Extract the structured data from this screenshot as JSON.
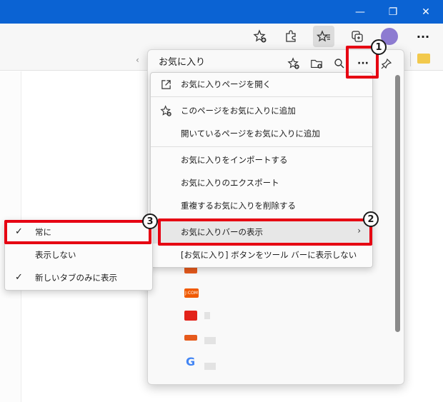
{
  "titlebar": {
    "minimize_glyph": "—",
    "maximize_glyph": "❐",
    "close_glyph": "✕"
  },
  "toolbar": {
    "more_glyph": "···"
  },
  "favorites_panel": {
    "title": "お気に入り",
    "more_glyph": "···",
    "search_glyph": "⚲"
  },
  "menu": {
    "items": [
      {
        "label": "お気に入りページを開く"
      },
      {
        "label": "このページをお気に入りに追加"
      },
      {
        "label": "開いているページをお気に入りに追加"
      },
      {
        "label": "お気に入りをインポートする"
      },
      {
        "label": "お気に入りのエクスポート"
      },
      {
        "label": "重複するお気に入りを削除する"
      },
      {
        "label": "お気に入りバーの表示",
        "arrow": "›"
      },
      {
        "label": "[お気に入り] ボタンをツール バーに表示しない"
      }
    ]
  },
  "submenu": {
    "items": [
      {
        "label": "常に",
        "check": "✓"
      },
      {
        "label": "表示しない"
      },
      {
        "label": "新しいタブのみに表示",
        "check": "✓"
      }
    ]
  },
  "favorite_entries": [
    {
      "label": "",
      "color": "#e65a1c"
    },
    {
      "label": "J:COM",
      "color": "#f05a00"
    },
    {
      "label": "",
      "color": "#e2231a"
    },
    {
      "label": "",
      "color": "#e65a1c"
    },
    {
      "label": "G",
      "color": "#4285f4"
    }
  ],
  "callouts": {
    "one": "1",
    "two": "2",
    "three": "3"
  },
  "colors": {
    "accent": "#0b63d3",
    "highlight": "#e60012",
    "avatar": "#8d7bd1"
  }
}
